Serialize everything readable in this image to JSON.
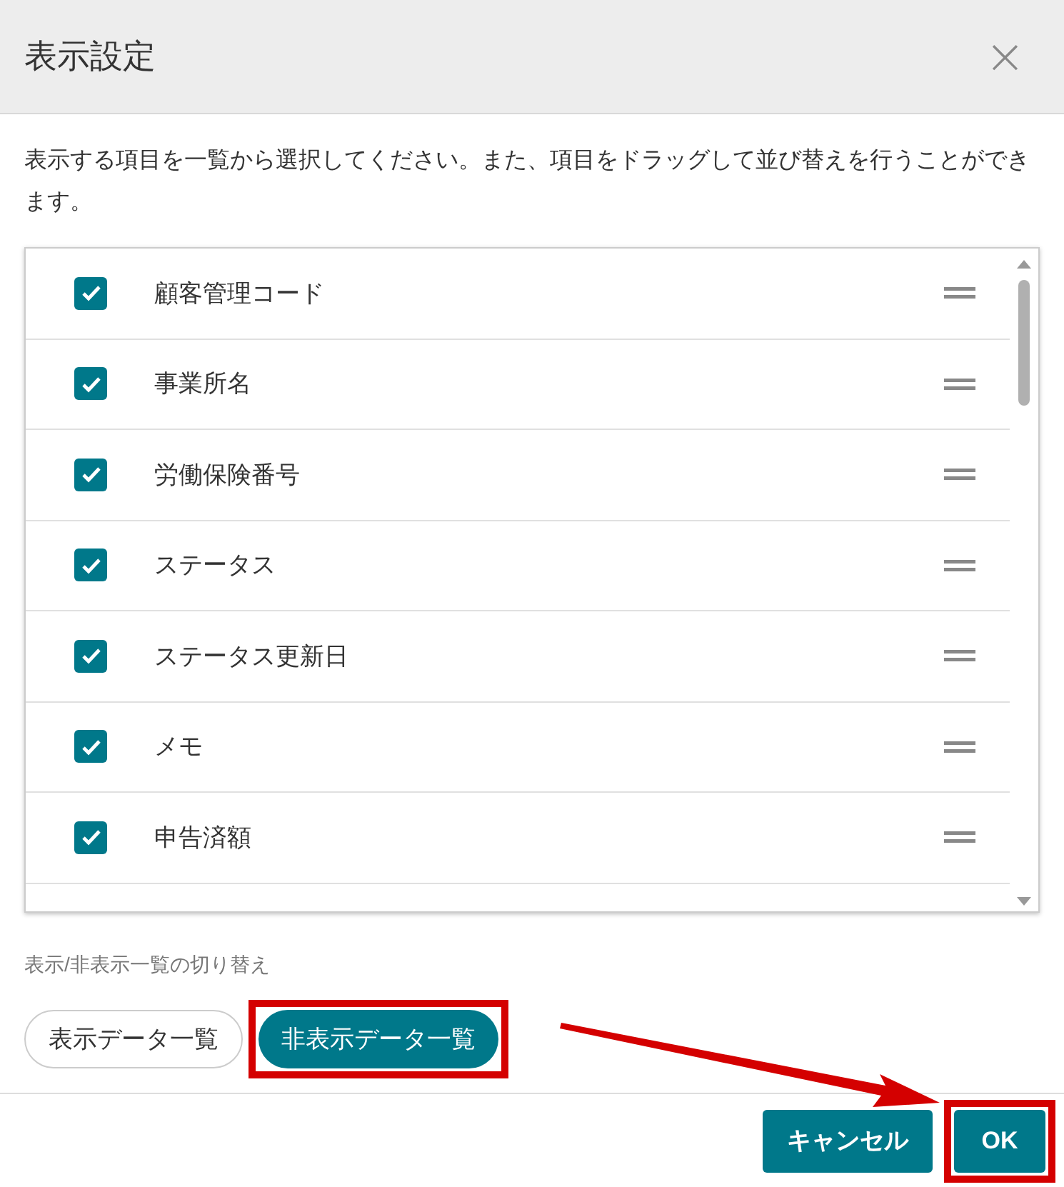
{
  "dialog": {
    "title": "表示設定",
    "close_label": "×"
  },
  "description": "表示する項目を一覧から選択してください。また、項目をドラッグして並び替えを行うことができます。",
  "items": [
    {
      "label": "顧客管理コード",
      "checked": true
    },
    {
      "label": "事業所名",
      "checked": true
    },
    {
      "label": "労働保険番号",
      "checked": true
    },
    {
      "label": "ステータス",
      "checked": true
    },
    {
      "label": "ステータス更新日",
      "checked": true
    },
    {
      "label": "メモ",
      "checked": true
    },
    {
      "label": "申告済額",
      "checked": true
    }
  ],
  "toggle": {
    "caption": "表示/非表示一覧の切り替え",
    "options": [
      {
        "label": "表示データ一覧",
        "selected": false,
        "highlighted": false
      },
      {
        "label": "非表示データ一覧",
        "selected": true,
        "highlighted": true
      }
    ]
  },
  "footer_buttons": [
    {
      "label": "キャンセル",
      "highlighted": false
    },
    {
      "label": "OK",
      "highlighted": true
    }
  ]
}
